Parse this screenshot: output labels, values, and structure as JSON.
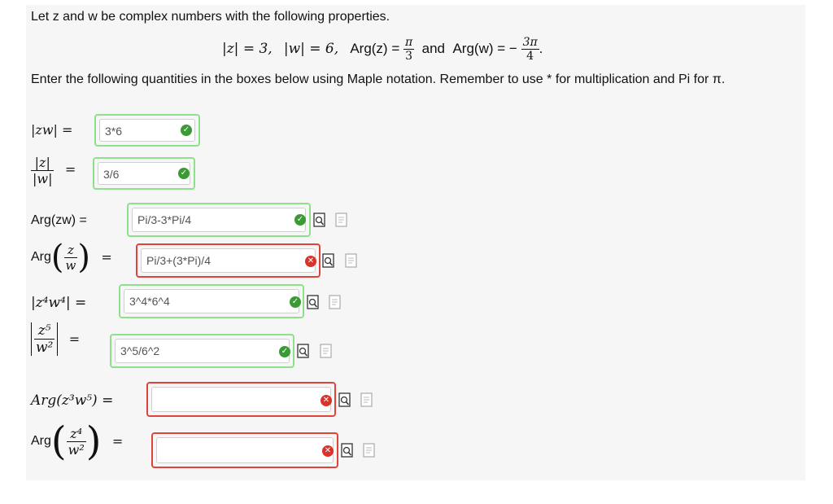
{
  "intro_text": "Let z and w be complex numbers with the following properties.",
  "props": {
    "mod_z": "|z| = 3,",
    "mod_w": "|w| = 6,",
    "arg_z": "Arg(z) =",
    "arg_z_num": "π",
    "arg_z_den": "3",
    "and": "and",
    "arg_w": "Arg(w) = −",
    "arg_w_num": "3π",
    "arg_w_den": "4",
    "period": "."
  },
  "instructions": "Enter the following quantities in the boxes below using Maple notation. Remember to use * for multiplication and Pi for π.",
  "rows": [
    {
      "label": "|zw| =",
      "value": "3*6",
      "status": "correct"
    },
    {
      "label_num": "|z|",
      "label_den": "|w|",
      "eq": "=",
      "value": "3/6",
      "status": "correct"
    },
    {
      "label": "Arg(zw) =",
      "value": "Pi/3-3*Pi/4",
      "status": "correct"
    },
    {
      "arg": "Arg",
      "label_num": "z",
      "label_den": "w",
      "eq": "=",
      "value": "Pi/3+(3*Pi)/4",
      "status": "incorrect"
    },
    {
      "label": "|z⁴w⁴| =",
      "value": "3^4*6^4",
      "status": "correct"
    },
    {
      "label_num": "z⁵",
      "label_den": "w²",
      "eq": "=",
      "value": "3^5/6^2",
      "status": "correct"
    },
    {
      "label": "Arg(z³w⁵) =",
      "value": "",
      "status": "incorrect"
    },
    {
      "arg": "Arg",
      "label_num": "z⁴",
      "label_den": "w²",
      "eq": "=",
      "value": "",
      "status": "incorrect"
    }
  ],
  "icons": {
    "correct": "checkmark-icon",
    "incorrect": "x-circle-icon",
    "preview": "preview-icon",
    "help": "help-document-icon"
  },
  "colors": {
    "correct_border": "#8fe08a",
    "incorrect_border": "#e0433a",
    "correct_icon": "#3c9a34",
    "incorrect_icon": "#d8342c"
  }
}
